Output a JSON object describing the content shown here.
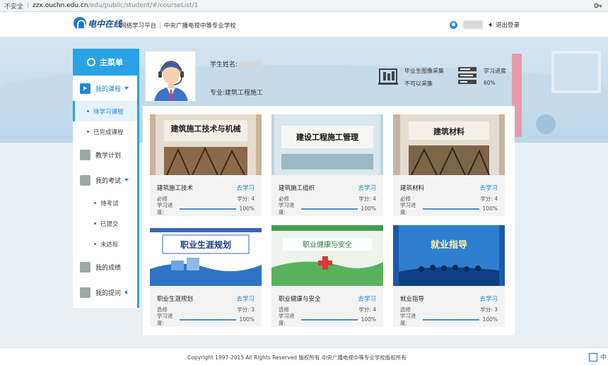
{
  "browser": {
    "security": "不安全",
    "host": "zzx.ouchn.edu.cn",
    "path": "/edu/public/student/#/courseList/1"
  },
  "header": {
    "logo_text": "电中在线",
    "platform_name": "网络学习平台",
    "school_name": "中央广播电视中等专业学校",
    "logout": "退出登录"
  },
  "sidebar": {
    "title": "主菜单",
    "my_courses": "我的课程",
    "pending": "待学习课程",
    "completed": "已完成课程",
    "teaching_plan": "教学计划",
    "my_exams": "我的考试",
    "exam_pending": "待考试",
    "exam_submitted": "已提交",
    "exam_failed": "未达标",
    "my_grades": "我的成绩",
    "my_questions": "我的提问"
  },
  "profile": {
    "name_label": "学生姓名:",
    "major_label": "专业:",
    "major_value": "建筑工程施工"
  },
  "stats": {
    "photo_title": "毕业生图像采集",
    "photo_status": "不可以采集",
    "progress_title": "学习进度",
    "progress_value": "60%"
  },
  "course_labels": {
    "go": "去学习",
    "progress_label": "学习进度:"
  },
  "courses": [
    {
      "title": "建筑施工技术",
      "type": "必修",
      "credit": "学分: 4",
      "progress": 1.0,
      "pct": "100%"
    },
    {
      "title": "建筑施工组织",
      "type": "必修",
      "credit": "学分: 4",
      "progress": 1.0,
      "pct": "100%"
    },
    {
      "title": "建筑材料",
      "type": "必修",
      "credit": "学分: 4",
      "progress": 1.0,
      "pct": "100%"
    },
    {
      "title": "职业生涯规划",
      "type": "选修",
      "credit": "学分: 3",
      "progress": 1.0,
      "pct": "100%"
    },
    {
      "title": "职业健康与安全",
      "type": "选修",
      "credit": "学分: 4",
      "progress": 1.0,
      "pct": "100%"
    },
    {
      "title": "就业指导",
      "type": "选修",
      "credit": "学分: 3",
      "progress": 1.0,
      "pct": "100%"
    }
  ],
  "covers": {
    "c1_text": "建筑施工技术与机械",
    "c2_text": "建设工程施工管理",
    "c3_text": "建筑材料",
    "c4_text": "职业生涯规划",
    "c5_text": "职业健康与安全",
    "c6_text": "就业指导"
  },
  "footer": {
    "copyright": "Copyright 1997-2015 All Rights Reserved 版权所有 中央广播电视中等专业学校版权所有",
    "corner": "中"
  },
  "colors": {
    "accent": "#29a3e6",
    "link": "#1e88d8"
  }
}
